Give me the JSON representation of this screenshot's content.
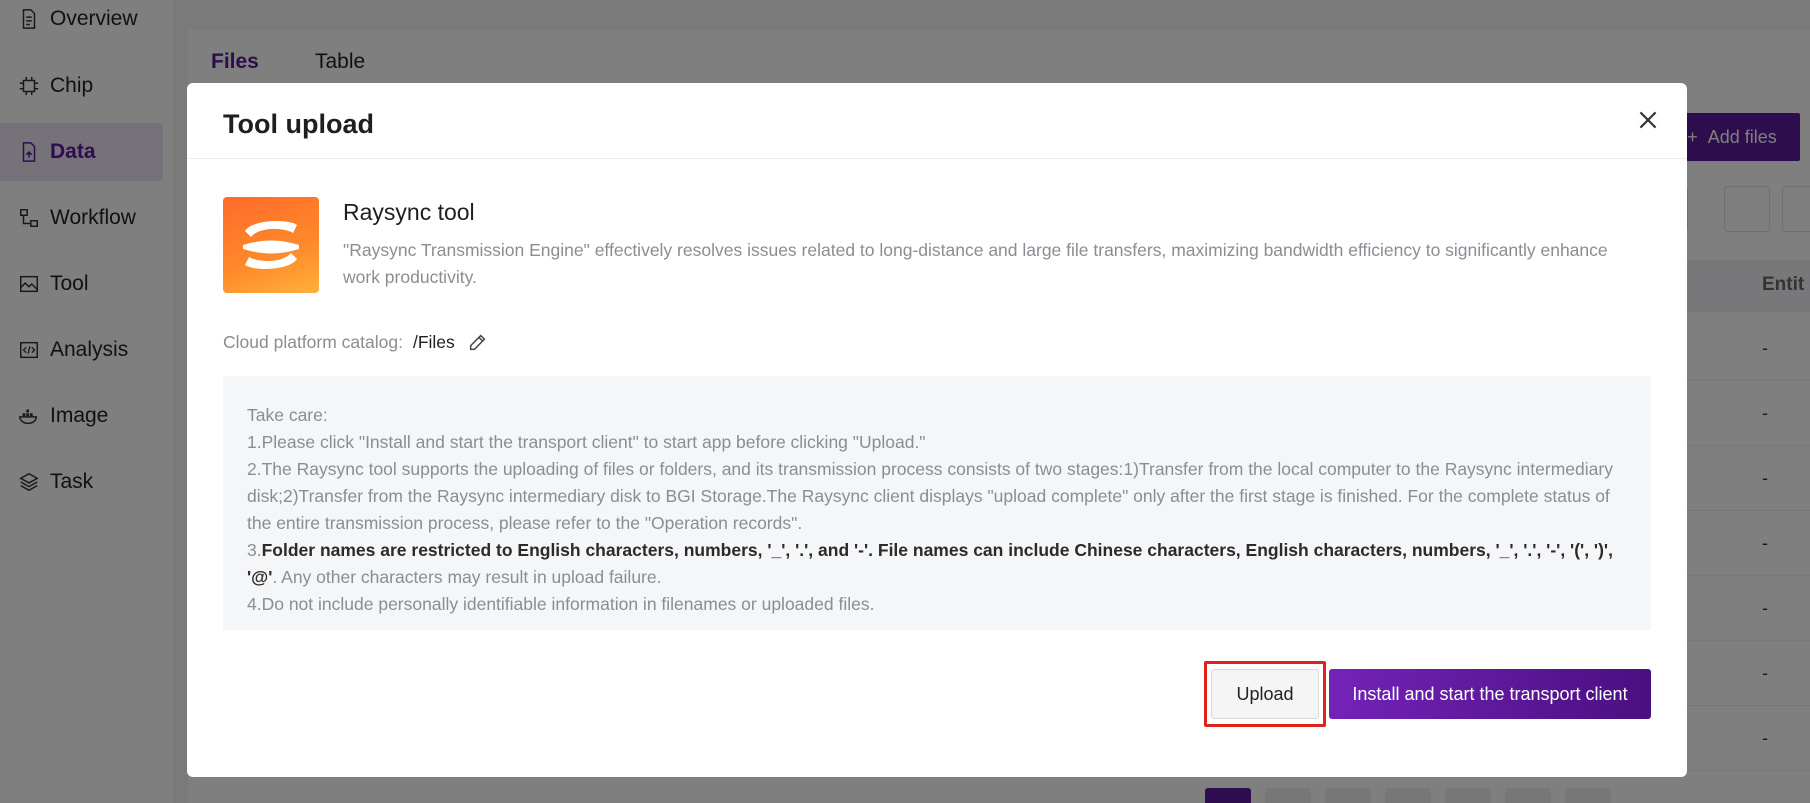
{
  "sidebar": {
    "items": [
      {
        "label": "Overview",
        "icon": "document-icon"
      },
      {
        "label": "Chip",
        "icon": "chip-icon"
      },
      {
        "label": "Data",
        "icon": "data-file-icon",
        "active": true
      },
      {
        "label": "Workflow",
        "icon": "workflow-icon"
      },
      {
        "label": "Tool",
        "icon": "tool-icon"
      },
      {
        "label": "Analysis",
        "icon": "analysis-icon"
      },
      {
        "label": "Image",
        "icon": "docker-icon"
      },
      {
        "label": "Task",
        "icon": "layers-icon"
      }
    ]
  },
  "main": {
    "tabs": [
      {
        "label": "Files",
        "active": true
      },
      {
        "label": "Table",
        "active": false
      }
    ],
    "add_files_label": "Add files",
    "entity_column": "Entit",
    "row_values": [
      "-",
      "-",
      "-",
      "-",
      "-",
      "-",
      "-"
    ]
  },
  "modal": {
    "title": "Tool upload",
    "tool_name": "Raysync tool",
    "tool_description": "\"Raysync Transmission Engine\" effectively resolves issues related to long-distance and large file transfers, maximizing bandwidth efficiency to significantly enhance work productivity.",
    "catalog_label": "Cloud platform catalog:",
    "catalog_value": "/Files",
    "notes": {
      "heading": "Take care:",
      "item1": "1.Please click \"Install and start the transport client\" to start app before clicking \"Upload.\"",
      "item2": "2.The Raysync tool supports the uploading of files or folders, and its transmission process consists of two stages:1)Transfer from the local computer to the Raysync intermediary disk;2)Transfer from the Raysync intermediary disk to BGI Storage.The Raysync client displays \"upload complete\" only after the first stage is finished. For the complete status of the entire transmission process, please refer to the \"Operation records\".",
      "item3_prefix": "3.",
      "item3_bold": "Folder names are restricted to English characters, numbers, '_', '.', and '-'. File names can include Chinese characters, English characters, numbers, '_', '.', '-', '(', ')', '@'",
      "item3_suffix": ". Any other characters may result in upload failure.",
      "item4": "4.Do not include personally identifiable information in filenames or uploaded files."
    },
    "upload_label": "Upload",
    "install_label": "Install and start the transport client"
  },
  "colors": {
    "accent": "#5b1a9a",
    "highlight": "#e0231e",
    "logo": "#ff7a2a"
  }
}
